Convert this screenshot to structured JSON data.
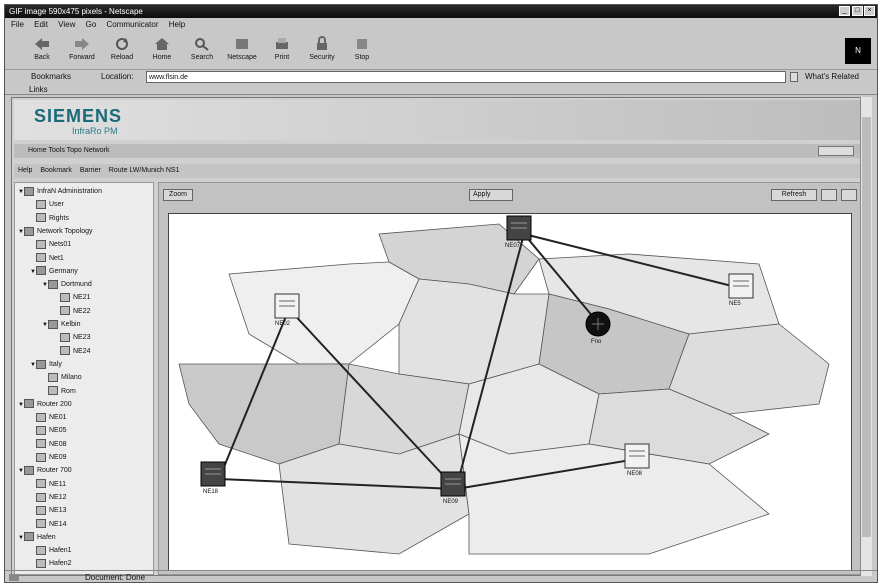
{
  "window": {
    "title": "GIF image 590x475 pixels - Netscape",
    "controls": [
      "_",
      "□",
      "×"
    ]
  },
  "menu": [
    "File",
    "Edit",
    "View",
    "Go",
    "Communicator",
    "Help"
  ],
  "toolbar": {
    "buttons": [
      "Back",
      "Forward",
      "Reload",
      "Home",
      "Search",
      "Netscape",
      "Print",
      "Security",
      "Stop"
    ],
    "logo": "N"
  },
  "location": {
    "bookmarks_label": "Bookmarks",
    "location_label": "Location:",
    "url": "www.flsin.de",
    "related_label": "What's Related"
  },
  "links": {
    "label": "Links"
  },
  "page": {
    "brand": "SIEMENS",
    "product": "InfraRo PM",
    "breadcrumb": "Home   Tools   Topo Network",
    "nav_items": [
      "Help",
      "Bookmark",
      "Barrier",
      "Route LW/Munich NS1"
    ],
    "map_toolbar": {
      "left_button": "Zoom",
      "center_select": "Apply",
      "right_button": "Refresh"
    }
  },
  "tree": [
    {
      "label": "InfraN Administration",
      "level": 0,
      "group": true
    },
    {
      "label": "User",
      "level": 1,
      "group": false
    },
    {
      "label": "Rights",
      "level": 1,
      "group": false
    },
    {
      "label": "Network Topology",
      "level": 0,
      "group": true
    },
    {
      "label": "Nets01",
      "level": 1,
      "group": false
    },
    {
      "label": "Net1",
      "level": 1,
      "group": false
    },
    {
      "label": "Germany",
      "level": 1,
      "group": true
    },
    {
      "label": "Dortmund",
      "level": 2,
      "group": true
    },
    {
      "label": "NE21",
      "level": 3,
      "group": false
    },
    {
      "label": "NE22",
      "level": 3,
      "group": false
    },
    {
      "label": "Kelbin",
      "level": 2,
      "group": true
    },
    {
      "label": "NE23",
      "level": 3,
      "group": false
    },
    {
      "label": "NE24",
      "level": 3,
      "group": false
    },
    {
      "label": "Italy",
      "level": 1,
      "group": true
    },
    {
      "label": "Milano",
      "level": 2,
      "group": false
    },
    {
      "label": "Rom",
      "level": 2,
      "group": false
    },
    {
      "label": "Router 200",
      "level": 0,
      "group": true
    },
    {
      "label": "NE01",
      "level": 1,
      "group": false
    },
    {
      "label": "NE05",
      "level": 1,
      "group": false
    },
    {
      "label": "NE08",
      "level": 1,
      "group": false
    },
    {
      "label": "NE09",
      "level": 1,
      "group": false
    },
    {
      "label": "Router 700",
      "level": 0,
      "group": true
    },
    {
      "label": "NE11",
      "level": 1,
      "group": false
    },
    {
      "label": "NE12",
      "level": 1,
      "group": false
    },
    {
      "label": "NE13",
      "level": 1,
      "group": false
    },
    {
      "label": "NE14",
      "level": 1,
      "group": false
    },
    {
      "label": "Hafen",
      "level": 0,
      "group": true
    },
    {
      "label": "Hafen1",
      "level": 1,
      "group": false
    },
    {
      "label": "Hafen2",
      "level": 1,
      "group": false
    }
  ],
  "map_nodes": [
    {
      "id": "NE07",
      "style": "dark"
    },
    {
      "id": "NE5",
      "style": "light"
    },
    {
      "id": "NE02",
      "style": "light"
    },
    {
      "id": "Fno",
      "style": "round"
    },
    {
      "id": "NE18",
      "style": "dark"
    },
    {
      "id": "NE09",
      "style": "dark"
    },
    {
      "id": "NE08",
      "style": "light"
    }
  ],
  "status": {
    "text": "Document: Done",
    "left_icon": "security-icon"
  }
}
